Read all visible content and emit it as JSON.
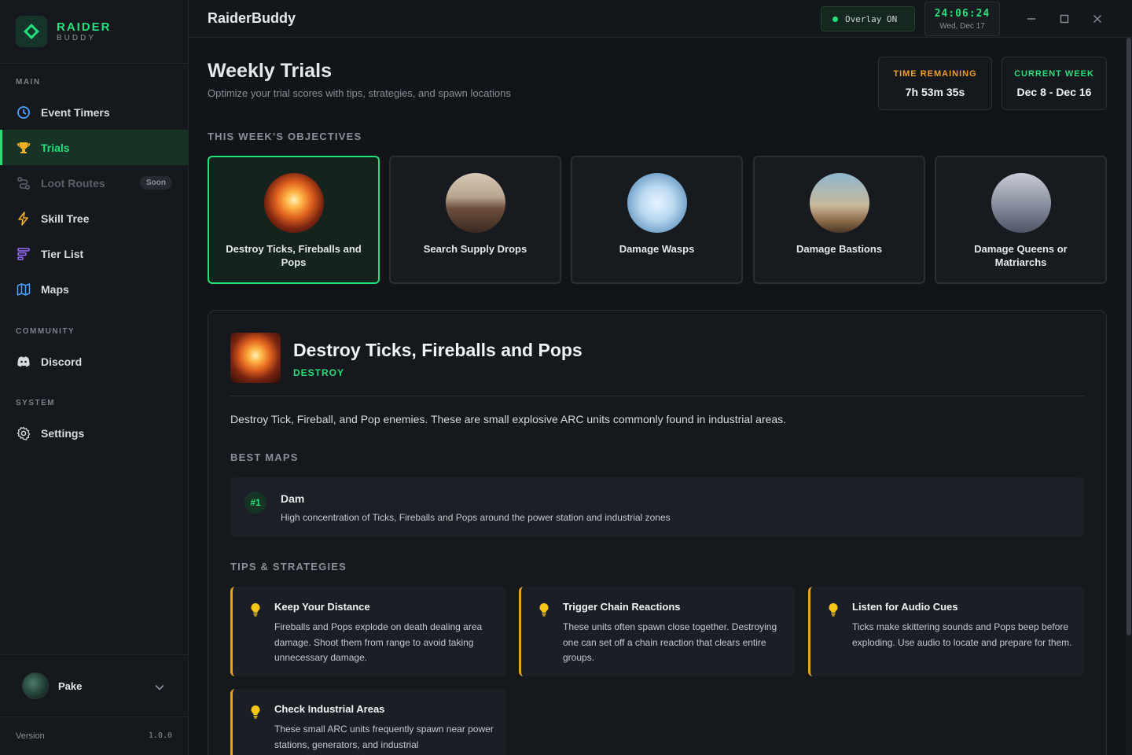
{
  "brand": {
    "name": "RAIDER",
    "sub": "BUDDY"
  },
  "sidebar": {
    "sections": {
      "main": "MAIN",
      "community": "COMMUNITY",
      "system": "SYSTEM"
    },
    "items": [
      {
        "label": "Event Timers",
        "icon": "clock-icon"
      },
      {
        "label": "Trials",
        "icon": "trophy-icon"
      },
      {
        "label": "Loot Routes",
        "icon": "route-icon",
        "badge": "Soon"
      },
      {
        "label": "Skill Tree",
        "icon": "bolt-icon"
      },
      {
        "label": "Tier List",
        "icon": "list-icon"
      },
      {
        "label": "Maps",
        "icon": "map-icon"
      },
      {
        "label": "Discord",
        "icon": "discord-icon"
      },
      {
        "label": "Settings",
        "icon": "gear-icon"
      }
    ],
    "user": {
      "name": "Pake"
    },
    "version_label": "Version",
    "version": "1.0.0"
  },
  "topbar": {
    "title": "RaiderBuddy",
    "overlay": "Overlay ON",
    "clock_time": "24:06:24",
    "clock_date": "Wed, Dec 17"
  },
  "page": {
    "title": "Weekly Trials",
    "subtitle": "Optimize your trial scores with tips, strategies, and spawn locations",
    "time_remaining_label": "TIME REMAINING",
    "time_remaining": "7h 53m 35s",
    "current_week_label": "CURRENT WEEK",
    "current_week": "Dec 8 - Dec 16",
    "objectives_heading": "THIS WEEK'S OBJECTIVES"
  },
  "objectives": [
    {
      "label": "Destroy Ticks, Fireballs and Pops"
    },
    {
      "label": "Search Supply Drops"
    },
    {
      "label": "Damage Wasps"
    },
    {
      "label": "Damage Bastions"
    },
    {
      "label": "Damage Queens or Matriarchs"
    }
  ],
  "detail": {
    "title": "Destroy Ticks, Fireballs and Pops",
    "tag": "DESTROY",
    "description": "Destroy Tick, Fireball, and Pop enemies. These are small explosive ARC units commonly found in industrial areas.",
    "best_maps_heading": "BEST MAPS",
    "maps": [
      {
        "rank": "#1",
        "name": "Dam",
        "desc": "High concentration of Ticks, Fireballs and Pops around the power station and industrial zones"
      }
    ],
    "tips_heading": "TIPS & STRATEGIES",
    "tips": [
      {
        "title": "Keep Your Distance",
        "text": "Fireballs and Pops explode on death dealing area damage. Shoot them from range to avoid taking unnecessary damage."
      },
      {
        "title": "Trigger Chain Reactions",
        "text": "These units often spawn close together. Destroying one can set off a chain reaction that clears entire groups."
      },
      {
        "title": "Listen for Audio Cues",
        "text": "Ticks make skittering sounds and Pops beep before exploding. Use audio to locate and prepare for them."
      },
      {
        "title": "Check Industrial Areas",
        "text": "These small ARC units frequently spawn near power stations, generators, and industrial"
      }
    ]
  },
  "colors": {
    "accent": "#22e07a",
    "warning": "#f0a020",
    "bg": "#111418"
  }
}
